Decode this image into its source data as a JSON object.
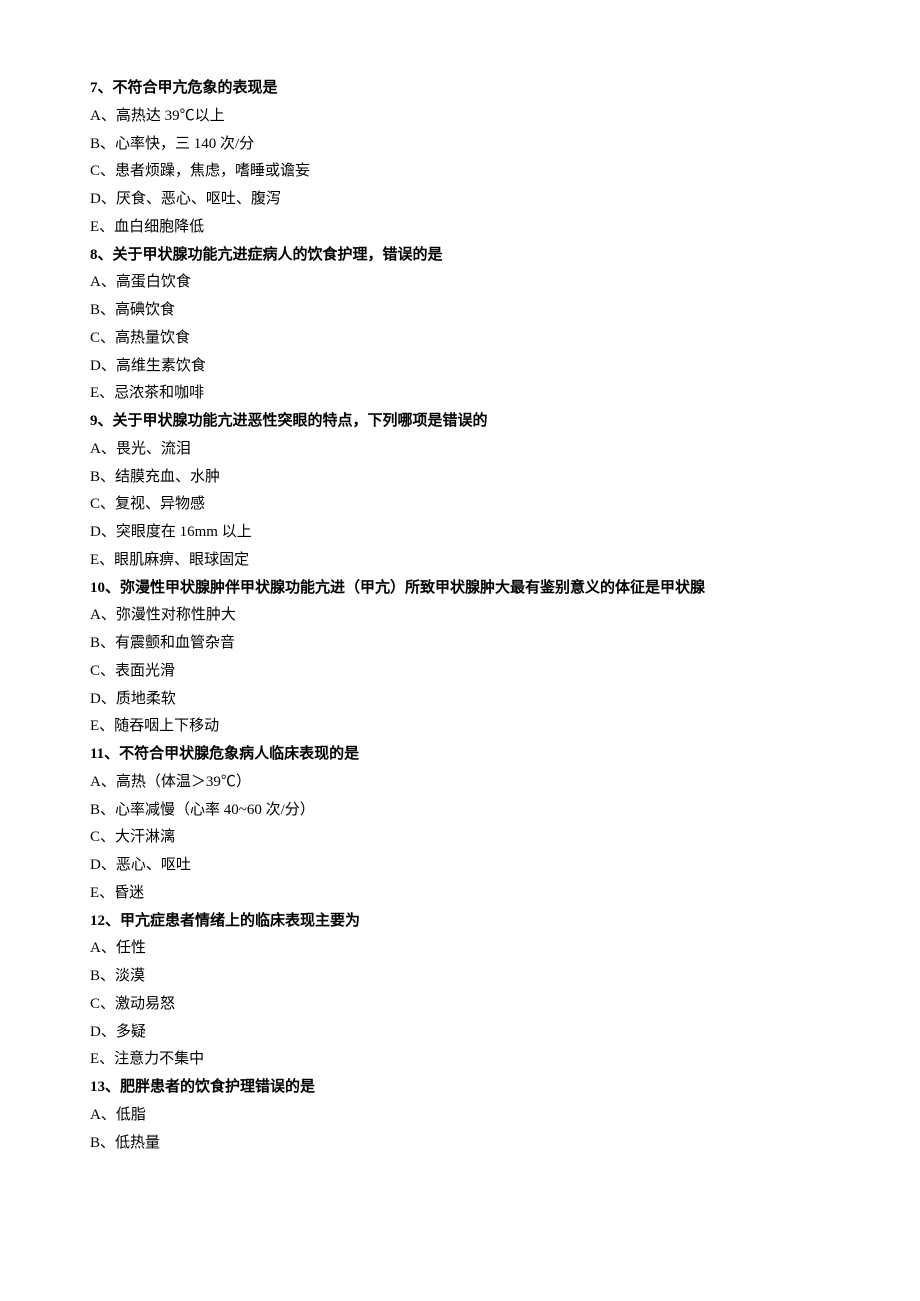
{
  "questions": [
    {
      "stem": "7、不符合甲亢危象的表现是",
      "options": [
        "A、高热达 39℃以上",
        "B、心率快，三 140 次/分",
        "C、患者烦躁，焦虑，嗜睡或谵妄",
        "D、厌食、恶心、呕吐、腹泻",
        "E、血白细胞降低"
      ]
    },
    {
      "stem": "8、关于甲状腺功能亢进症病人的饮食护理，错误的是",
      "options": [
        "A、高蛋白饮食",
        "B、高碘饮食",
        "C、高热量饮食",
        "D、高维生素饮食",
        "E、忌浓茶和咖啡"
      ]
    },
    {
      "stem": "9、关于甲状腺功能亢进恶性突眼的特点，下列哪项是错误的",
      "options": [
        "A、畏光、流泪",
        "B、结膜充血、水肿",
        "C、复视、异物感",
        "D、突眼度在 16mm 以上",
        "E、眼肌麻痹、眼球固定"
      ]
    },
    {
      "stem": "10、弥漫性甲状腺肿伴甲状腺功能亢进（甲亢）所致甲状腺肿大最有鉴别意义的体征是甲状腺",
      "options": [
        "A、弥漫性对称性肿大",
        "B、有震颤和血管杂音",
        "C、表面光滑",
        "D、质地柔软",
        "E、随吞咽上下移动"
      ]
    },
    {
      "stem": "11、不符合甲状腺危象病人临床表现的是",
      "options": [
        "A、高热（体温＞39℃）",
        "B、心率减慢（心率 40~60 次/分）",
        "C、大汗淋漓",
        "D、恶心、呕吐",
        "E、昏迷"
      ]
    },
    {
      "stem": "12、甲亢症患者情绪上的临床表现主要为",
      "options": [
        "A、任性",
        "B、淡漠",
        "C、激动易怒",
        "D、多疑",
        "E、注意力不集中"
      ]
    },
    {
      "stem": "13、肥胖患者的饮食护理错误的是",
      "options": [
        "A、低脂",
        "B、低热量"
      ]
    }
  ]
}
